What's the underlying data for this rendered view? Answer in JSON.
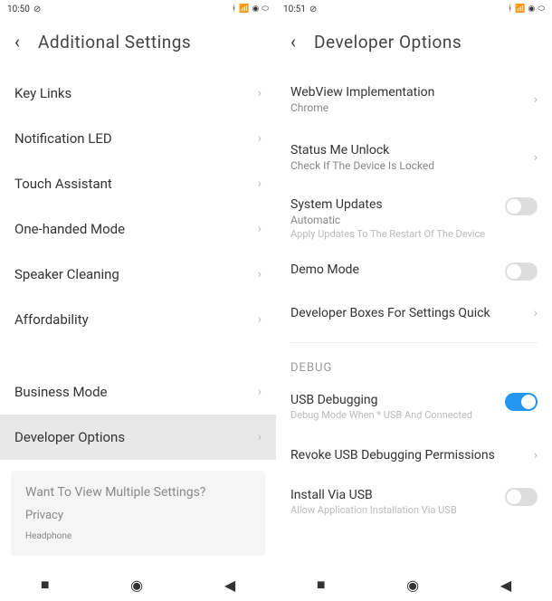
{
  "left": {
    "status": {
      "time": "10:50",
      "icons": "✱ ⚡ ⚍ ⚇ ⚊"
    },
    "header": {
      "title": "Additional Settings"
    },
    "items": [
      {
        "label": "Key Links"
      },
      {
        "label": "Notification LED"
      },
      {
        "label": "Touch Assistant"
      },
      {
        "label": "One-handed Mode"
      },
      {
        "label": "Speaker Cleaning"
      },
      {
        "label": "Affordability"
      },
      {
        "label": "Business Mode"
      },
      {
        "label": "Developer Options"
      }
    ],
    "card": {
      "line1": "Want To View Multiple Settings?",
      "line2": "Privacy",
      "line3": "Headphone"
    }
  },
  "right": {
    "status": {
      "time": "10:51"
    },
    "header": {
      "title": "Developer Options"
    },
    "items": {
      "webview": {
        "label": "WebView Implementation",
        "sub": "Chrome"
      },
      "statusme": {
        "label": "Status Me Unlock",
        "sub": "Check If The Device Is Locked"
      },
      "sysupdate": {
        "label": "System Updates",
        "sub": "Automatic",
        "desc": "Apply Updates To The Restart Of The Device"
      },
      "demo": {
        "label": "Demo Mode"
      },
      "devboxes": {
        "label": "Developer Boxes For Settings Quick"
      },
      "debug_section": "DEBUG",
      "usbdebug": {
        "label": "USB Debugging",
        "desc": "Debug Mode When * USB And Connected"
      },
      "revoke": {
        "label": "Revoke USB Debugging Permissions"
      },
      "installusb": {
        "label": "Install Via USB",
        "desc": "Allow Application Installation Via USB"
      }
    }
  }
}
